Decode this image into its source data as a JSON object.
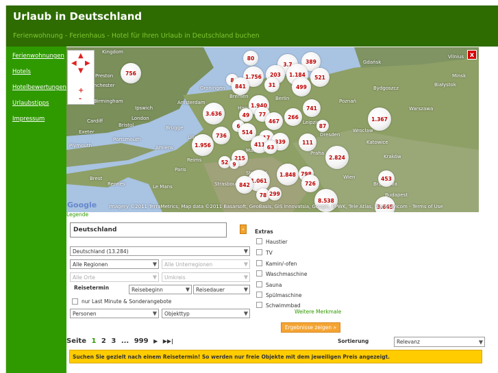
{
  "header": {
    "title": "Urlaub in Deutschland",
    "tagline": "Ferienwohnung - Ferienhaus - Hotel für Ihren Urlaub in Deutschland buchen"
  },
  "sidebar": {
    "items": [
      {
        "label": "Ferienwohnungen"
      },
      {
        "label": "Hotels"
      },
      {
        "label": "Hotelbewertungen"
      },
      {
        "label": "Urlaubstipps"
      },
      {
        "label": "Impressum"
      }
    ]
  },
  "map": {
    "clusters": [
      "80",
      "3.7",
      "389",
      "756",
      "203",
      "1.756",
      "8",
      "841",
      "31",
      "1.184",
      "499",
      "521",
      "1.940",
      "741",
      "3.636",
      "49",
      "77",
      "467",
      "266",
      "1.367",
      "87",
      "6",
      "514",
      "736",
      "1.956",
      "17",
      "339",
      "411",
      "63",
      "111",
      "215",
      "2.824",
      "52",
      "9",
      "1.848",
      "798",
      "1.061",
      "842",
      "726",
      "453",
      "78",
      "299",
      "8.538",
      "3.645"
    ],
    "cities": [
      "Kingdom",
      "Preston",
      "nchester",
      "Birmingham",
      "Cardiff",
      "Bristol",
      "Exeter",
      "Plymouth",
      "Portsmouth",
      "Amsterdam",
      "Groningen",
      "Bremen",
      "Hannover",
      "Berlin",
      "Leipzig",
      "Dresden",
      "Poznań",
      "Warszawa",
      "Gdańsk",
      "Bydgoszcz",
      "Wrocław",
      "Kraków",
      "Praha",
      "Paris",
      "Brest",
      "Rennes",
      "Le Mans",
      "Strasbourg",
      "Wien",
      "Bratislava",
      "Budapest",
      "Vilnius",
      "Minsk",
      "Białystok",
      "Katowice",
      "Reims",
      "Amiens",
      "Brugge",
      "Main",
      "Ipswich",
      "London",
      "Lille",
      "Stuttgart"
    ],
    "close_label": "x",
    "attribution": "Imagery ©2011 TerraMetrics, Map data ©2011 Basarsoft, GeoBasis, GIS Innovatsia, Google, PPWK, Tele Atlas, Transnavicom - Terms of Use",
    "google": "Google"
  },
  "legend_link": "Legende",
  "search": {
    "value": "Deutschland",
    "go_label": "»"
  },
  "filters": {
    "country": "Deutschland (13.284)",
    "region": "Alle Regionen",
    "subregion": "Alle Unterregionen",
    "place": "Alle Orte",
    "radius": "Umkreis",
    "travel_label": "Reisetermin",
    "start": "Reisebeginn",
    "duration": "Reisedauer",
    "lastminute": "nur Last Minute & Sonderangebote",
    "persons": "Personen",
    "type": "Objekttyp"
  },
  "extras": {
    "title": "Extras",
    "items": [
      "Haustier",
      "TV",
      "Kamin/-ofen",
      "Waschmaschine",
      "Sauna",
      "Spülmaschine",
      "Schwimmbad"
    ],
    "more": "Weitere Merkmale"
  },
  "results_button": "Ergebnisse zeigen »",
  "pager": {
    "label": "Seite",
    "current": "1",
    "p2": "2",
    "p3": "3",
    "ellipsis": "...",
    "last": "999",
    "next_icon": "▶",
    "end_icon": "▶▶|"
  },
  "sort": {
    "label": "Sortierung",
    "value": "Relevanz"
  },
  "notice": "Suchen Sie gezielt nach einem Reisetermin! So werden nur freie Objekte mit dem jeweiligen Preis angezeigt.",
  "colors": {
    "header": "#2e6b00",
    "sidebar": "#2f9a00",
    "accent_orange": "#f4a433",
    "notice": "#ffcc00",
    "cluster_text": "#c00000"
  }
}
